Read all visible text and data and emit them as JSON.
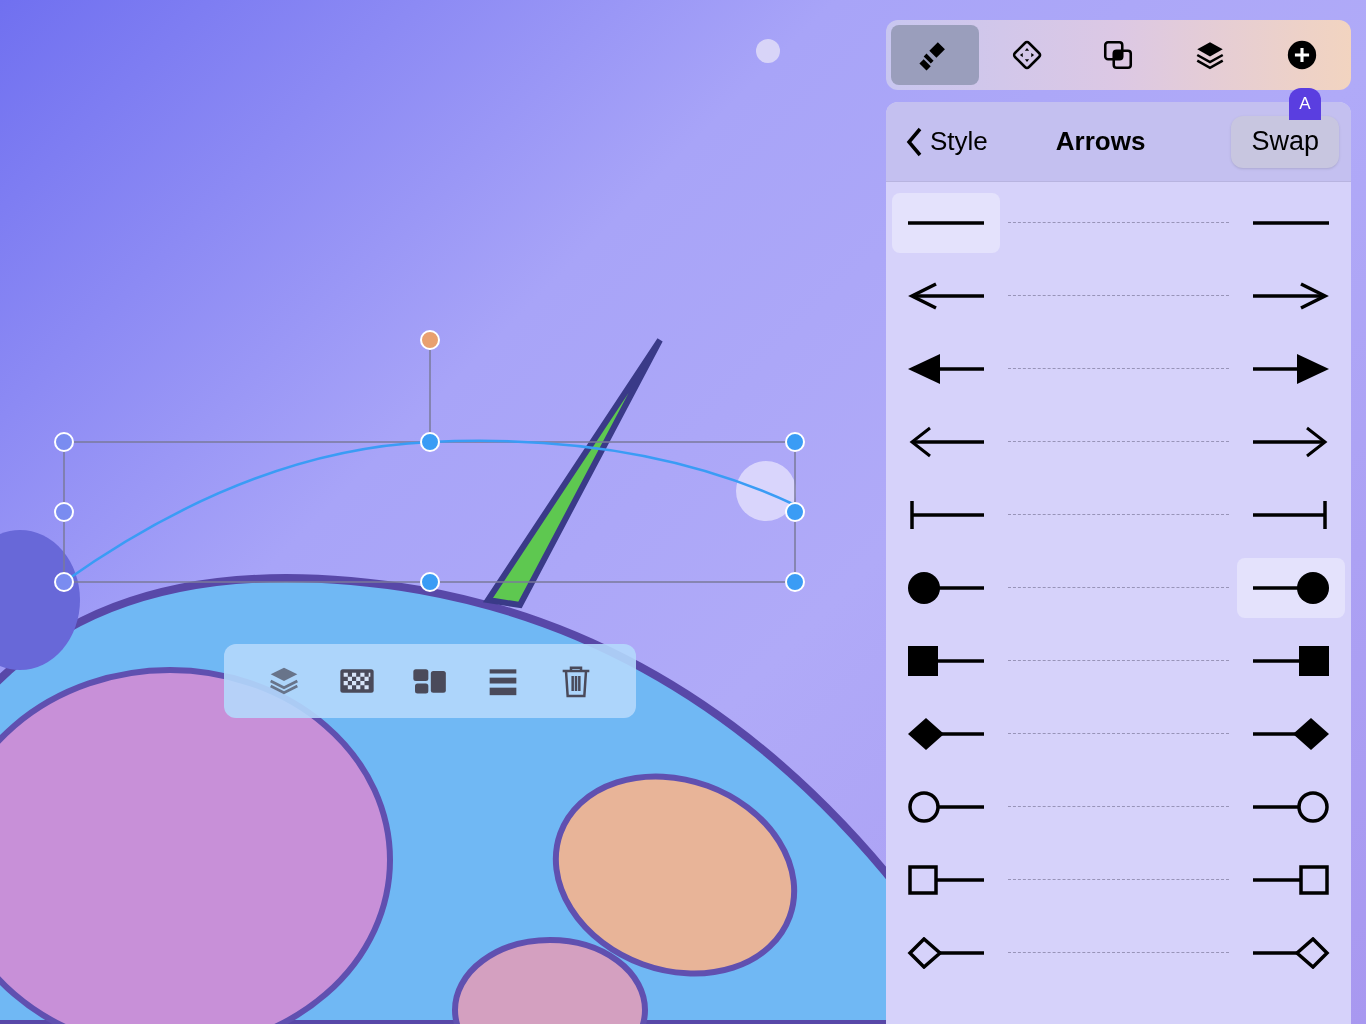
{
  "toolbar": {
    "tabs": [
      {
        "kind": "brush",
        "selected": true
      },
      {
        "kind": "shape",
        "selected": false
      },
      {
        "kind": "combine",
        "selected": false
      },
      {
        "kind": "layers",
        "selected": false
      },
      {
        "kind": "add",
        "selected": false
      }
    ]
  },
  "badge": "A",
  "panel": {
    "back": "Style",
    "title": "Arrows",
    "action": "Swap",
    "rows": [
      {
        "kind": "none",
        "start_selected": true,
        "end_selected": false
      },
      {
        "kind": "open",
        "start_selected": false,
        "end_selected": false
      },
      {
        "kind": "filled",
        "start_selected": false,
        "end_selected": false
      },
      {
        "kind": "thin",
        "start_selected": false,
        "end_selected": false
      },
      {
        "kind": "bar",
        "start_selected": false,
        "end_selected": false
      },
      {
        "kind": "circle",
        "start_selected": false,
        "end_selected": true
      },
      {
        "kind": "square",
        "start_selected": false,
        "end_selected": false
      },
      {
        "kind": "diamond",
        "start_selected": false,
        "end_selected": false
      },
      {
        "kind": "circle-outline",
        "start_selected": false,
        "end_selected": false
      },
      {
        "kind": "square-outline",
        "start_selected": false,
        "end_selected": false
      },
      {
        "kind": "diamond-outline",
        "start_selected": false,
        "end_selected": false
      }
    ]
  },
  "context_bar": {
    "tools": [
      {
        "kind": "arrange"
      },
      {
        "kind": "opacity"
      },
      {
        "kind": "layout"
      },
      {
        "kind": "lines"
      },
      {
        "kind": "delete"
      }
    ]
  }
}
